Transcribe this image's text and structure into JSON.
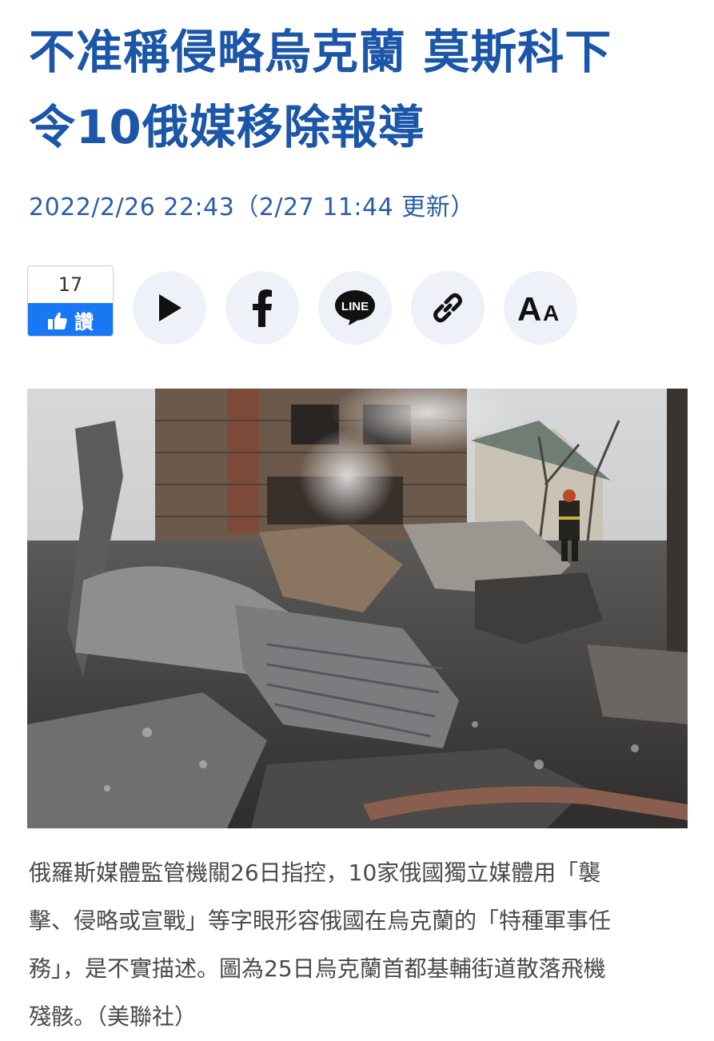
{
  "article": {
    "title_lines": [
      "不准稱侵略烏克蘭 莫斯科下",
      "令10俄媒移除報導"
    ],
    "dateline": "2022/2/26 22:43（2/27 11:44 更新）"
  },
  "social": {
    "like_count": "17",
    "like_label": "讚",
    "buttons": [
      {
        "icon": "play-icon"
      },
      {
        "icon": "facebook-icon"
      },
      {
        "icon": "line-icon",
        "label": "LINE"
      },
      {
        "icon": "link-icon"
      },
      {
        "icon": "font-size-icon",
        "label_big": "A",
        "label_small": "A"
      }
    ]
  },
  "photo": {
    "subject": "burned aircraft wreckage debris in front of damaged brick building with firefighter"
  },
  "caption_lines": [
    "俄羅斯媒體監管機關26日指控，10家俄國獨立媒體用「襲",
    "擊、侵略或宣戰」等字眼形容俄國在烏克蘭的「特種軍事任",
    "務」，是不實描述。圖為25日烏克蘭首都基輔街道散落飛機",
    "殘骸。（美聯社）"
  ],
  "colors": {
    "title": "#1c56a8",
    "dateline": "#2b5ea6",
    "like_blue": "#1877f2",
    "share_bg": "#eef2f8",
    "caption": "#4a4a4a"
  }
}
